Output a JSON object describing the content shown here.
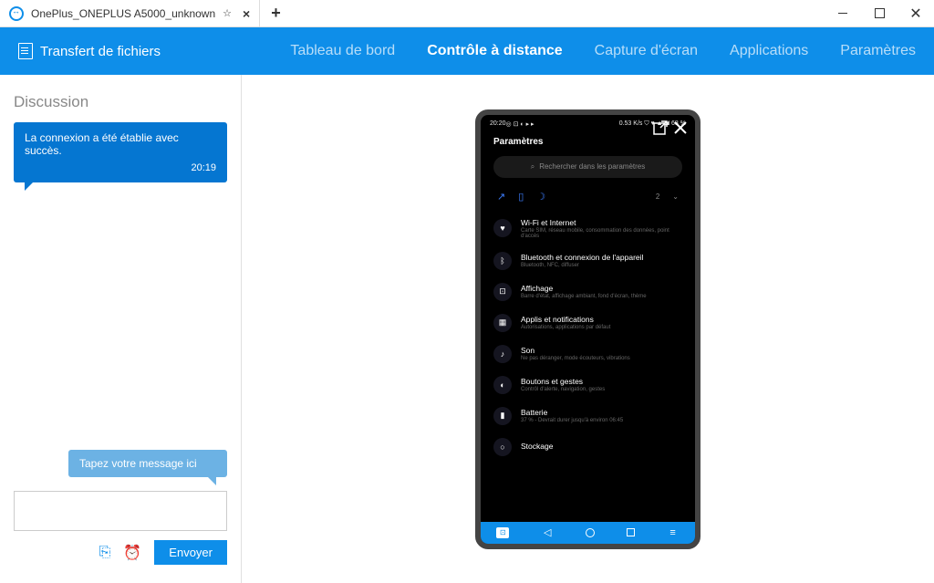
{
  "tab": {
    "title": "OnePlus_ONEPLUS A5000_unknown"
  },
  "topbar": {
    "file_transfer": "Transfert de fichiers",
    "nav": [
      "Tableau de bord",
      "Contrôle à distance",
      "Capture d'écran",
      "Applications",
      "Paramètres"
    ],
    "active_index": 1
  },
  "chat": {
    "title": "Discussion",
    "message": "La connexion a été établie avec succès.",
    "time": "20:19",
    "hint": "Tapez votre message ici",
    "send": "Envoyer"
  },
  "phone": {
    "status_time": "20:20",
    "status_left_icons": "◎ ⊡ ◐ ▸ ▸",
    "status_right": "0.53 K/s ⛉ ♥ ▲ ◢ 68 %",
    "screen_title": "Paramètres",
    "search_placeholder": "Rechercher dans les paramètres",
    "quick_badge": "2",
    "items": [
      {
        "icon": "♥",
        "title": "Wi-Fi et Internet",
        "sub": "Carte SIM, réseau mobile, consommation des données, point d'accès"
      },
      {
        "icon": "ᛒ",
        "title": "Bluetooth et connexion de l'appareil",
        "sub": "Bluetooth, NFC, diffuser"
      },
      {
        "icon": "⊡",
        "title": "Affichage",
        "sub": "Barre d'état, affichage ambiant, fond d'écran, thème"
      },
      {
        "icon": "▦",
        "title": "Applis et notifications",
        "sub": "Autorisations, applications par défaut"
      },
      {
        "icon": "♪",
        "title": "Son",
        "sub": "Ne pas déranger, mode écouteurs, vibrations"
      },
      {
        "icon": "◐",
        "title": "Boutons et gestes",
        "sub": "Contrôl d'alerte, navigation, gestes"
      },
      {
        "icon": "▮",
        "title": "Batterie",
        "sub": "37 % - Devrait durer jusqu'à environ 06:45"
      },
      {
        "icon": "○",
        "title": "Stockage",
        "sub": ""
      }
    ]
  }
}
